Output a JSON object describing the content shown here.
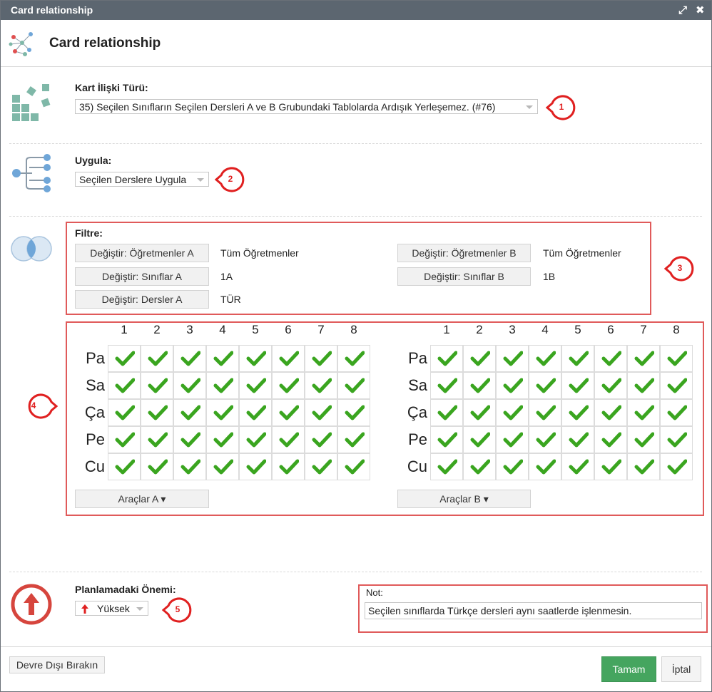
{
  "window": {
    "title": "Card relationship"
  },
  "header": {
    "title": "Card relationship"
  },
  "card_type": {
    "label": "Kart İlişki Türü:",
    "value": "35) Seçilen Sınıfların Seçilen Dersleri A ve B Grubundaki Tablolarda Ardışık Yerleşemez. (#76)"
  },
  "apply": {
    "label": "Uygula:",
    "value": "Seçilen Derslere Uygula"
  },
  "filter": {
    "label": "Filtre:",
    "teachers_a_btn": "Değiştir: Öğretmenler A",
    "teachers_a_val": "Tüm Öğretmenler",
    "classes_a_btn": "Değiştir: Sınıflar A",
    "classes_a_val": "1A",
    "subjects_a_btn": "Değiştir: Dersler A",
    "subjects_a_val": "TÜR",
    "teachers_b_btn": "Değiştir: Öğretmenler B",
    "teachers_b_val": "Tüm Öğretmenler",
    "classes_b_btn": "Değiştir: Sınıflar B",
    "classes_b_val": "1B"
  },
  "timetable": {
    "periods": [
      "1",
      "2",
      "3",
      "4",
      "5",
      "6",
      "7",
      "8"
    ],
    "days": [
      "Pa",
      "Sa",
      "Ça",
      "Pe",
      "Cu"
    ],
    "grid_a": [
      [
        1,
        1,
        1,
        1,
        1,
        1,
        1,
        1
      ],
      [
        1,
        1,
        1,
        1,
        1,
        1,
        1,
        1
      ],
      [
        1,
        1,
        1,
        1,
        1,
        1,
        1,
        1
      ],
      [
        1,
        1,
        1,
        1,
        1,
        1,
        1,
        1
      ],
      [
        1,
        1,
        1,
        1,
        1,
        1,
        1,
        1
      ]
    ],
    "grid_b": [
      [
        1,
        1,
        1,
        1,
        1,
        1,
        1,
        1
      ],
      [
        1,
        1,
        1,
        1,
        1,
        1,
        1,
        1
      ],
      [
        1,
        1,
        1,
        1,
        1,
        1,
        1,
        1
      ],
      [
        1,
        1,
        1,
        1,
        1,
        1,
        1,
        1
      ],
      [
        1,
        1,
        1,
        1,
        1,
        1,
        1,
        1
      ]
    ],
    "tools_a": "Araçlar A ▾",
    "tools_b": "Araçlar B ▾"
  },
  "importance": {
    "label": "Planlamadaki Önemi:",
    "value": "Yüksek"
  },
  "note": {
    "label": "Not:",
    "value": "Seçilen sınıflarda Türkçe dersleri aynı saatlerde işlenmesin."
  },
  "markers": [
    "1",
    "2",
    "3",
    "4",
    "5"
  ],
  "footer": {
    "disable": "Devre Dışı Bırakın",
    "ok": "Tamam",
    "cancel": "İptal"
  },
  "colors": {
    "titlebar": "#5c6670",
    "accent_red": "#e02020",
    "check_green": "#3aa51f",
    "ok_button": "#45a55f",
    "icon_teal": "#7fb8a8",
    "icon_blue": "#6fa6d8"
  }
}
